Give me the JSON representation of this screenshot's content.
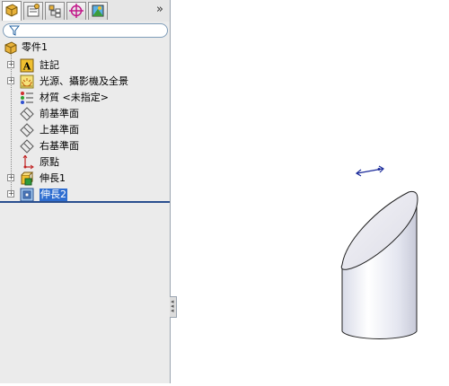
{
  "toolbar": {
    "tabs": [
      {
        "name": "feature-manager",
        "icon": "feature-manager-icon"
      },
      {
        "name": "property-manager",
        "icon": "property-manager-icon"
      },
      {
        "name": "configuration-manager",
        "icon": "configuration-manager-icon"
      },
      {
        "name": "dimxpert-manager",
        "icon": "dimxpert-icon"
      },
      {
        "name": "display-manager",
        "icon": "display-manager-icon"
      }
    ],
    "more_glyph": "»"
  },
  "filter": {
    "icon": "filter-icon"
  },
  "tree": {
    "root": {
      "label": "零件1",
      "icon": "part-icon"
    },
    "items": [
      {
        "label": "註記",
        "icon": "annotations-icon",
        "expandable": true
      },
      {
        "label": "光源、攝影機及全景",
        "icon": "lights-camera-icon",
        "expandable": true
      },
      {
        "label": "材質 <未指定>",
        "icon": "material-icon",
        "expandable": false
      },
      {
        "label": "前基準面",
        "icon": "plane-icon",
        "expandable": false
      },
      {
        "label": "上基準面",
        "icon": "plane-icon",
        "expandable": false
      },
      {
        "label": "右基準面",
        "icon": "plane-icon",
        "expandable": false
      },
      {
        "label": "原點",
        "icon": "origin-icon",
        "expandable": false
      },
      {
        "label": "伸長1",
        "icon": "extrude-icon",
        "expandable": true
      },
      {
        "label": "伸長2",
        "icon": "extrude-icon",
        "expandable": true,
        "selected": true
      }
    ],
    "expand_glyph": "+"
  },
  "colors": {
    "selection": "#2e6dd0",
    "rollback_bar": "#2a4f8f",
    "panel": "#ebebeb"
  }
}
